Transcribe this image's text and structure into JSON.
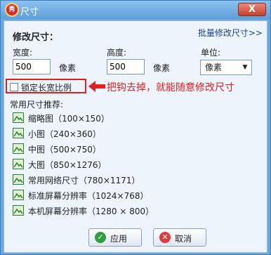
{
  "window": {
    "title": "尺寸",
    "app_icon_text": "秀",
    "close_label": "X"
  },
  "section_title": "修改尺寸：",
  "batch_link": "批量修改尺寸>>",
  "width": {
    "label": "宽度:",
    "value": "500",
    "unit": "像素"
  },
  "height": {
    "label": "高度:",
    "value": "500",
    "unit": "像素"
  },
  "unit": {
    "label": "单位:",
    "selected": "像素"
  },
  "lock_ratio": {
    "label": "锁定长宽比例",
    "checked": false
  },
  "annotation": {
    "text": "把钩去掉，就能随意修改尺寸",
    "color": "#e02020"
  },
  "presets": {
    "header": "常用尺寸推荐:",
    "items": [
      {
        "label": "缩略图（100×150）"
      },
      {
        "label": "小图（240×360）"
      },
      {
        "label": "中图（500×750）"
      },
      {
        "label": "大图（850×1276）"
      },
      {
        "label": "常用网络尺寸（780×1171）"
      },
      {
        "label": "标准屏幕分辨率（1024×768）"
      },
      {
        "label": "本机屏幕分辨率（1280 × 800）"
      }
    ]
  },
  "buttons": {
    "ok": "应用",
    "cancel": "取消"
  }
}
